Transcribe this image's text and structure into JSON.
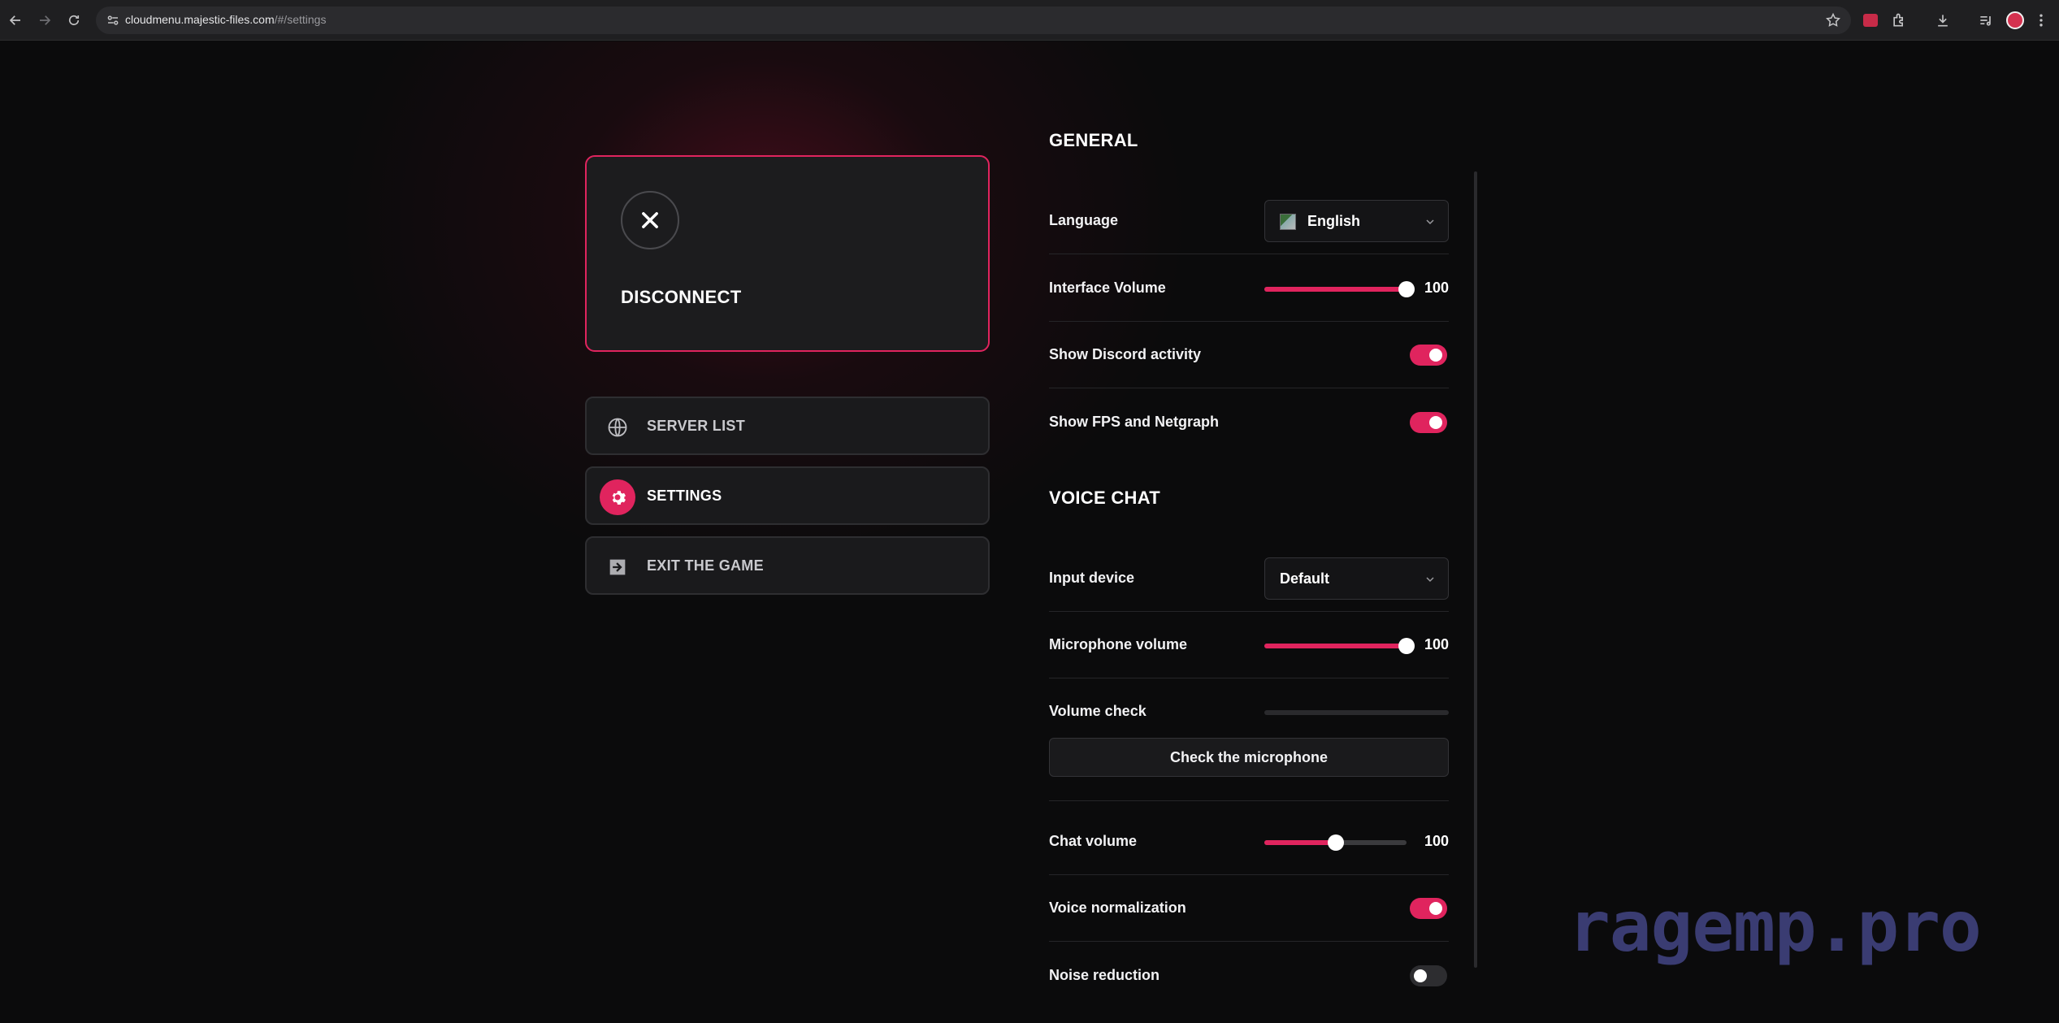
{
  "browser": {
    "url_host": "cloudmenu.majestic-files.com",
    "url_path": "/#/settings"
  },
  "menu": {
    "disconnect": "DISCONNECT",
    "items": [
      {
        "label": "SERVER LIST",
        "icon": "globe-icon"
      },
      {
        "label": "SETTINGS",
        "icon": "gear-icon",
        "active": true
      },
      {
        "label": "EXIT THE GAME",
        "icon": "exit-icon"
      }
    ]
  },
  "general": {
    "title": "GENERAL",
    "language_label": "Language",
    "language_value": "English",
    "interface_volume_label": "Interface Volume",
    "interface_volume": 100,
    "discord_label": "Show Discord activity",
    "discord_on": true,
    "fps_label": "Show FPS and Netgraph",
    "fps_on": true
  },
  "voice": {
    "title": "VOICE CHAT",
    "input_label": "Input device",
    "input_value": "Default",
    "mic_volume_label": "Microphone volume",
    "mic_volume": 100,
    "volume_check_label": "Volume check",
    "volume_check_level": 0,
    "check_button": "Check the microphone",
    "chat_volume_label": "Chat volume",
    "chat_volume": 100,
    "chat_volume_slider_fraction": 0.5,
    "normalization_label": "Voice normalization",
    "normalization_on": true,
    "noise_label": "Noise reduction",
    "noise_on": false
  },
  "watermark": "ragemp.pro",
  "colors": {
    "accent": "#e0245e",
    "background": "#0b0b0c",
    "watermark": "#3a3c72"
  }
}
